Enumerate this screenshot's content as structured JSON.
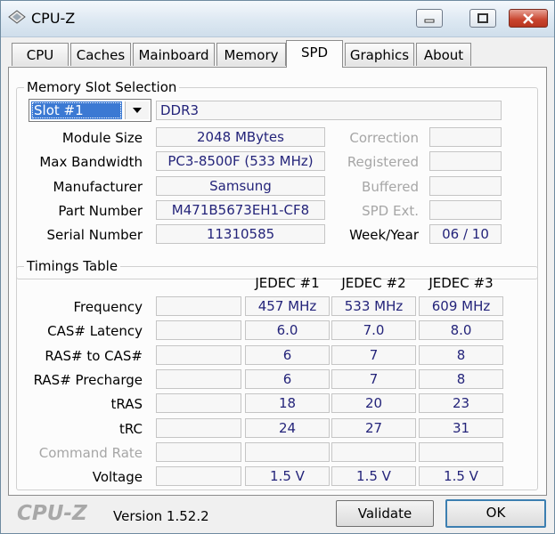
{
  "window": {
    "title": "CPU-Z"
  },
  "tabs": [
    "CPU",
    "Caches",
    "Mainboard",
    "Memory",
    "SPD",
    "Graphics",
    "About"
  ],
  "slot": {
    "group_title": "Memory Slot Selection",
    "selected": "Slot #1",
    "type": "DDR3",
    "labels": {
      "module_size": "Module Size",
      "max_bandwidth": "Max Bandwidth",
      "manufacturer": "Manufacturer",
      "part_number": "Part Number",
      "serial_number": "Serial Number",
      "correction": "Correction",
      "registered": "Registered",
      "buffered": "Buffered",
      "spd_ext": "SPD Ext.",
      "week_year": "Week/Year"
    },
    "values": {
      "module_size": "2048 MBytes",
      "max_bandwidth": "PC3-8500F (533 MHz)",
      "manufacturer": "Samsung",
      "part_number": "M471B5673EH1-CF8",
      "serial_number": "11310585",
      "week_year": "06 / 10"
    }
  },
  "timings": {
    "group_title": "Timings Table",
    "columns": [
      "JEDEC #1",
      "JEDEC #2",
      "JEDEC #3"
    ],
    "rows": [
      {
        "label": "Frequency",
        "values": [
          "457 MHz",
          "533 MHz",
          "609 MHz"
        ]
      },
      {
        "label": "CAS# Latency",
        "values": [
          "6.0",
          "7.0",
          "8.0"
        ]
      },
      {
        "label": "RAS# to CAS#",
        "values": [
          "6",
          "7",
          "8"
        ]
      },
      {
        "label": "RAS# Precharge",
        "values": [
          "6",
          "7",
          "8"
        ]
      },
      {
        "label": "tRAS",
        "values": [
          "18",
          "20",
          "23"
        ]
      },
      {
        "label": "tRC",
        "values": [
          "24",
          "27",
          "31"
        ]
      },
      {
        "label": "Command Rate",
        "values": [
          "",
          "",
          ""
        ]
      },
      {
        "label": "Voltage",
        "values": [
          "1.5 V",
          "1.5 V",
          "1.5 V"
        ]
      }
    ]
  },
  "footer": {
    "brand": "CPU-Z",
    "version": "Version 1.52.2",
    "validate_label": "Validate",
    "ok_label": "OK"
  }
}
